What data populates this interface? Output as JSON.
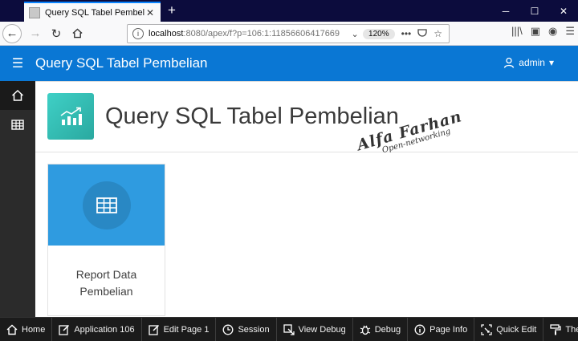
{
  "browser": {
    "tab_title": "Query SQL Tabel Pembelian",
    "url_host": "localhost",
    "url_path": ":8080/apex/f?p=106:1:11856606417669",
    "zoom": "120%"
  },
  "app": {
    "title": "Query SQL Tabel Pembelian",
    "user": "admin"
  },
  "page": {
    "title": "Query SQL Tabel Pembelian"
  },
  "watermark": {
    "name": "Alfa Farhan",
    "sub": "Open-networking"
  },
  "card": {
    "label_line1": "Report Data",
    "label_line2": "Pembelian"
  },
  "devbar": {
    "home": "Home",
    "application": "Application 106",
    "edit_page": "Edit Page 1",
    "session": "Session",
    "view_debug": "View Debug",
    "debug": "Debug",
    "page_info": "Page Info",
    "quick_edit": "Quick Edit",
    "theme": "Theme"
  },
  "colors": {
    "header": "#0a77d4",
    "card": "#2f9be0",
    "hero_icon": "#3fd0c6"
  }
}
